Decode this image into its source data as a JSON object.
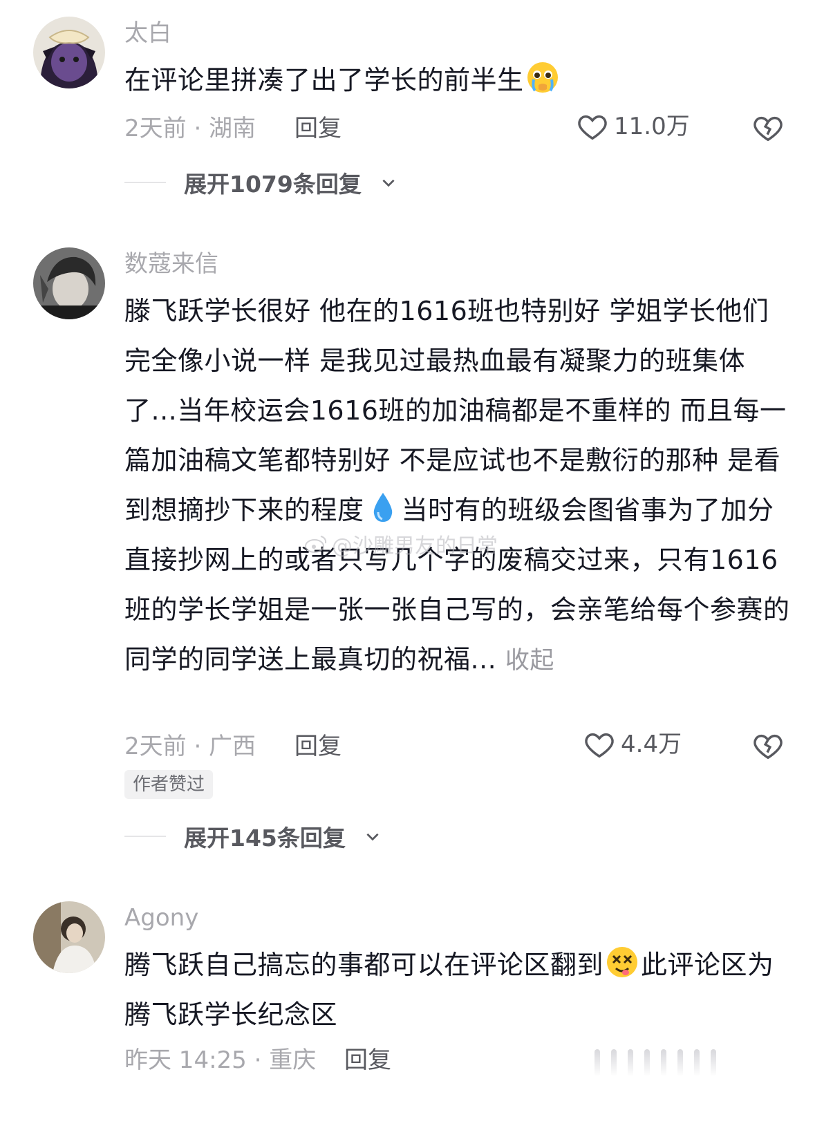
{
  "comments": [
    {
      "username": "太白",
      "text": "在评论里拼凑了出了学长的前半生",
      "emoji_after": "crying-pleading-emoji",
      "meta": "2天前 · 湖南",
      "reply_label": "回复",
      "likes": "11.0万",
      "expand_label": "展开1079条回复"
    },
    {
      "username": "数蔻来信",
      "text": "滕飞跃学长很好 他在的1616班也特别好 学姐学长他们完全像小说一样 是我见过最热血最有凝聚力的班集体了...当年校运会1616班的加油稿都是不重样的 而且每一篇加油稿文笔都特别好 不是应试也不是敷衍的那种 是看到想摘抄下来的程度",
      "emoji_mid": "droplet-emoji",
      "text_after": "当时有的班级会图省事为了加分直接抄网上的或者只写几个字的废稿交过来，只有1616班的学长学姐是一张一张自己写的，会亲笔给每个参赛的同学的同学送上最真切的祝福...",
      "collapse_label": "收起",
      "meta": "2天前 · 广西",
      "reply_label": "回复",
      "likes": "4.4万",
      "badge": "作者赞过",
      "expand_label": "展开145条回复"
    },
    {
      "username": "Agony",
      "text": "腾飞跃自己搞忘的事都可以在评论区翻到",
      "emoji_mid": "dizzy-face-emoji",
      "text_after": "此评论区为腾飞跃学长纪念区",
      "meta": "昨天 14:25 · 重庆",
      "reply_label": "回复"
    }
  ],
  "watermark": "@沙雕男友的日常",
  "colors": {
    "text": "#161823",
    "muted": "#a8a8ad",
    "action": "#58595f"
  }
}
